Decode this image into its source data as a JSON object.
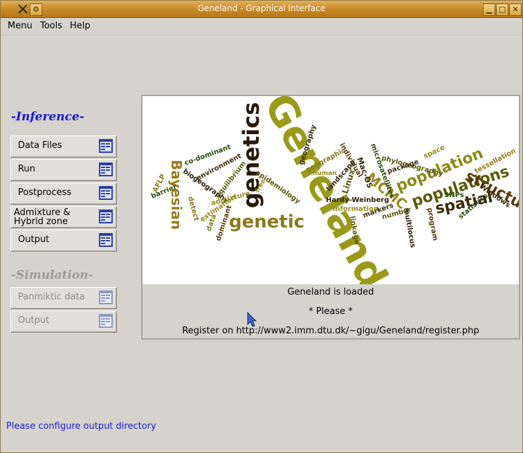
{
  "window": {
    "title": "Geneland - Graphical Interface"
  },
  "menubar": {
    "items": [
      "Menu",
      "Tools",
      "Help"
    ]
  },
  "inference": {
    "title": "-Inference-",
    "buttons": [
      "Data Files",
      "Run",
      "Postprocess",
      "Admixture &",
      "Hybrid zone",
      "Output"
    ]
  },
  "simulation": {
    "title": "-Simulation-",
    "buttons": [
      "Panmiktic data",
      "Output"
    ]
  },
  "wordcloud": {
    "words": [
      "Geneland",
      "genetics",
      "genetic",
      "Bayesian",
      "populations",
      "population",
      "spatial",
      "structure",
      "MCMC",
      "Hardy-Weinberg",
      "Linux",
      "Mac-OS",
      "microsatellites",
      "phylogeography",
      "landscape",
      "geographic",
      "individual",
      "information",
      "epidemiology",
      "co-dominant",
      "environment",
      "biogeography",
      "equilibrium",
      "AFLP",
      "barrier",
      "Windows",
      "SNPs",
      "program",
      "space",
      "package",
      "linkage",
      "multilocus",
      "markers",
      "number",
      "admixture",
      "statistics",
      "dominant",
      "data",
      "free",
      "human",
      "tessellation",
      "geography",
      "detect",
      "estimation"
    ]
  },
  "messages": {
    "loaded": "Geneland is loaded",
    "please": "* Please *",
    "register": "Register on http://www2.imm.dtu.dk/~gigu/Geneland/register.php"
  },
  "status": {
    "text": "Please configure output directory"
  },
  "colors": {
    "titlebar": "#c98a28",
    "inference_title": "#1515e0",
    "simulation_title": "#9a9a9a",
    "status_text": "#1b1bd1"
  }
}
